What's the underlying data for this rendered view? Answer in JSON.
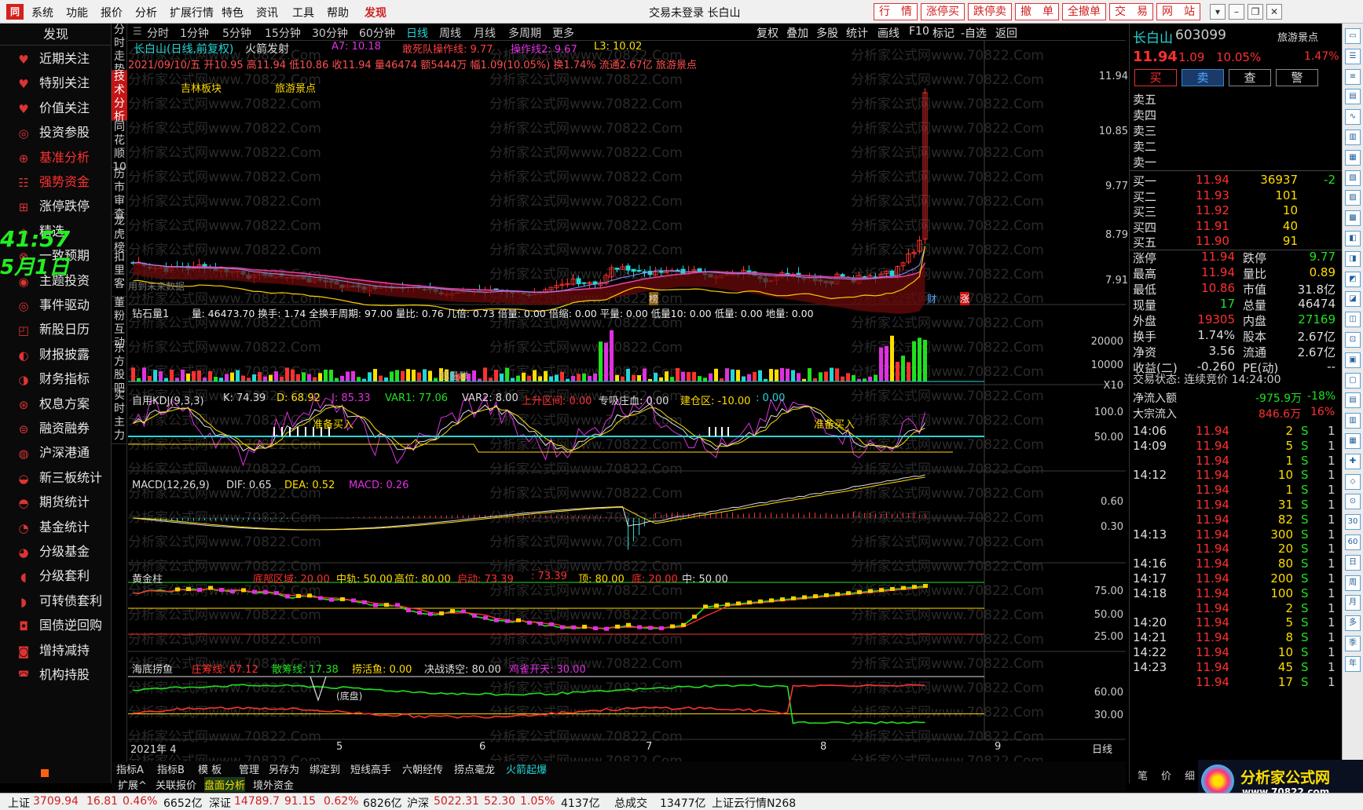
{
  "menubar": {
    "items": [
      "系统",
      "功能",
      "报价",
      "分析",
      "扩展行情",
      "特色",
      "资讯",
      "工具",
      "帮助"
    ],
    "faxian": "发现",
    "title": "交易未登录  长白山",
    "right_buttons": [
      "行　情",
      "涨停买",
      "跌停卖",
      "撤　单",
      "全撤单",
      "交　易",
      "网　站"
    ]
  },
  "sidebar": {
    "find": "发现",
    "items": [
      "近期关注",
      "特别关注",
      "价值关注",
      "投资参股",
      "基准分析",
      "强势资金",
      "涨停跌停",
      "精选",
      "一致预期",
      "主题投资",
      "事件驱动",
      "新股日历",
      "财报披露",
      "财务指标",
      "权息方案",
      "融资融券",
      "沪深港通",
      "新三板统计",
      "期货统计",
      "基金统计",
      "分级基金",
      "分级套利",
      "可转债套利",
      "国债逆回购",
      "增持减持",
      "机构持股"
    ],
    "clock": "41:57",
    "clock_date": "5月1日"
  },
  "vtabs": [
    "分时走势",
    "技术分析",
    "同花顺10",
    "历市审查",
    "龙虎榜",
    "扣里客",
    "董粉互动",
    "东方股吧",
    "实时主力"
  ],
  "periods": [
    "分时",
    "1分钟",
    "5分钟",
    "15分钟",
    "30分钟",
    "60分钟",
    "日线",
    "周线",
    "月线",
    "多周期",
    "更多"
  ],
  "tools": [
    "复权",
    "叠加",
    "多股",
    "统计",
    "画线",
    "F10",
    "标记",
    "-自选",
    "返回"
  ],
  "main": {
    "name": "长白山(日线,前复权)",
    "indicator": "火箭发射",
    "a7": "A7: 10.18",
    "lose": "敢死队操作线: 9.77",
    "op": "操作线2: 9.67",
    "l3": "L3: 10.02",
    "info": "2021/09/10/五  开10.95  高11.94  低10.86  收11.94  量46474  额5444万  幅1.09(10.05%)  换1.74%  流通2.67亿  旅游景点",
    "tag1": "吉林板块",
    "tag2": "旅游景点",
    "future": "用到未来数据",
    "bang": "榜",
    "cai": "财",
    "zhang": "涨",
    "yticks": [
      "11.94",
      "10.85",
      "9.77",
      "8.79",
      "7.91"
    ]
  },
  "vol": {
    "title": "钻石量1",
    "line": "量: 46473.70  换手: 1.74  全换手周期: 97.00  量比: 0.76  几倍: 0.73  倍量: 0.00  倍缩: 0.00  平量: 0.00  低量10: 0.00  低量: 0.00  地量: 0.00",
    "yticks": [
      "20000",
      "10000",
      "X10"
    ],
    "low": "低量群"
  },
  "kdj": {
    "title": "自用KDJ(9,3,3)",
    "k": "K: 74.39",
    "d": "D: 68.92",
    "j": "J: 85.33",
    "var1": "VAR1: 77.06",
    "var2": "VAR2: 8.00",
    "up": "上升区间: 0.00",
    "pro": "专吸庄血: 0.00",
    "build": "建仓区: -10.00",
    "zero": ": 0.00",
    "yticks": [
      "100.0",
      "50.00"
    ],
    "buy": "准备买入",
    "buy2": "准备买入"
  },
  "macd": {
    "title": "MACD(12,26,9)",
    "dif": "DIF: 0.65",
    "dea": "DEA: 0.52",
    "macd": "MACD: 0.26",
    "yticks": [
      "0.60",
      "0.30"
    ]
  },
  "gold": {
    "title": "黄金柱",
    "a": "底部区域: 20.00",
    "b": "中轨: 50.00",
    "c": "高位: 80.00",
    "d": "启动: 73.39",
    "e": ": 73.39",
    "f": "顶: 80.00",
    "g": "底: 20.00",
    "h": "中: 50.00",
    "yticks": [
      "75.00",
      "50.00",
      "25.00"
    ]
  },
  "fish": {
    "title": "海底捞鱼",
    "a": "庄筹线: 67.12",
    "b": "散筹线: 17.38",
    "c": "捞活鱼: 0.00",
    "d": "决战诱空: 80.00",
    "e": "鸡雀开天: 30.00",
    "yticks": [
      "60.00",
      "30.00"
    ],
    "tag": "(底盘)"
  },
  "xaxis": {
    "labels": [
      "2021年 4",
      "5",
      "6",
      "7",
      "8",
      "9"
    ],
    "right": "日线"
  },
  "subbar": {
    "tabs": [
      "指标A",
      "指标B",
      "模 板",
      "管理",
      "另存为",
      "绑定到",
      "短线高手",
      "六朝经传",
      "捞点毫龙",
      "火箭起爆"
    ],
    "tabs2": [
      "扩展^",
      "关联报价",
      "盘面分析",
      "境外资金"
    ]
  },
  "quote": {
    "name": "长白山",
    "code": "603099",
    "sector": "旅游景点",
    "price": "11.94",
    "chg": "1.09",
    "pct": "10.05%",
    "pct2": "1.47%",
    "btns": [
      "买",
      "卖",
      "查",
      "警"
    ],
    "asks": [
      "卖五",
      "卖四",
      "卖三",
      "卖二",
      "卖一"
    ],
    "bids": [
      {
        "l": "买一",
        "p": "11.94",
        "v": "36937",
        "x": "-2"
      },
      {
        "l": "买二",
        "p": "11.93",
        "v": "101",
        "x": ""
      },
      {
        "l": "买三",
        "p": "11.92",
        "v": "10",
        "x": ""
      },
      {
        "l": "买四",
        "p": "11.91",
        "v": "40",
        "x": ""
      },
      {
        "l": "买五",
        "p": "11.90",
        "v": "91",
        "x": ""
      }
    ],
    "stats": [
      {
        "a": "涨停",
        "b": "11.94",
        "c": "跌停",
        "d": "9.77"
      },
      {
        "a": "最高",
        "b": "11.94",
        "c": "量比",
        "d": "0.89"
      },
      {
        "a": "最低",
        "b": "10.86",
        "c": "市值",
        "d": "31.8亿"
      },
      {
        "a": "现量",
        "b": "17",
        "c": "总量",
        "d": "46474"
      },
      {
        "a": "外盘",
        "b": "19305",
        "c": "内盘",
        "d": "27169"
      },
      {
        "a": "换手",
        "b": "1.74%",
        "c": "股本",
        "d": "2.67亿"
      },
      {
        "a": "净资",
        "b": "3.56",
        "c": "流通",
        "d": "2.67亿"
      },
      {
        "a": "收益(二)",
        "b": "-0.260",
        "c": "PE(动)",
        "d": "--"
      }
    ],
    "status": "交易状态: 连续竞价 14:24:00",
    "flow1": {
      "a": "净流入额",
      "b": "-975.9万",
      "c": "-18%"
    },
    "flow2": {
      "a": "大宗流入",
      "b": "846.6万",
      "c": "16%"
    },
    "ticks": [
      {
        "t": "14:06",
        "p": "11.94",
        "v": "2",
        "s": "S",
        "n": "1"
      },
      {
        "t": "14:09",
        "p": "11.94",
        "v": "5",
        "s": "S",
        "n": "1"
      },
      {
        "t": "",
        "p": "11.94",
        "v": "1",
        "s": "S",
        "n": "1"
      },
      {
        "t": "14:12",
        "p": "11.94",
        "v": "10",
        "s": "S",
        "n": "1"
      },
      {
        "t": "",
        "p": "11.94",
        "v": "1",
        "s": "S",
        "n": "1"
      },
      {
        "t": "",
        "p": "11.94",
        "v": "31",
        "s": "S",
        "n": "1"
      },
      {
        "t": "",
        "p": "11.94",
        "v": "82",
        "s": "S",
        "n": "1"
      },
      {
        "t": "14:13",
        "p": "11.94",
        "v": "300",
        "s": "S",
        "n": "1"
      },
      {
        "t": "",
        "p": "11.94",
        "v": "20",
        "s": "S",
        "n": "1"
      },
      {
        "t": "14:16",
        "p": "11.94",
        "v": "80",
        "s": "S",
        "n": "1"
      },
      {
        "t": "14:17",
        "p": "11.94",
        "v": "200",
        "s": "S",
        "n": "1"
      },
      {
        "t": "14:18",
        "p": "11.94",
        "v": "100",
        "s": "S",
        "n": "1"
      },
      {
        "t": "",
        "p": "11.94",
        "v": "2",
        "s": "S",
        "n": "1"
      },
      {
        "t": "14:20",
        "p": "11.94",
        "v": "5",
        "s": "S",
        "n": "1"
      },
      {
        "t": "14:21",
        "p": "11.94",
        "v": "8",
        "s": "S",
        "n": "1"
      },
      {
        "t": "14:22",
        "p": "11.94",
        "v": "10",
        "s": "S",
        "n": "1"
      },
      {
        "t": "14:23",
        "p": "11.94",
        "v": "45",
        "s": "S",
        "n": "1"
      },
      {
        "t": "",
        "p": "11.94",
        "v": "17",
        "s": "S",
        "n": "1"
      }
    ],
    "tabs": [
      "笔",
      "价",
      "细"
    ]
  },
  "iconstrip": [
    "",
    "",
    "",
    "",
    "",
    "",
    "",
    "",
    "",
    "",
    "",
    "",
    "",
    "",
    "",
    "",
    "",
    "",
    "",
    "",
    "",
    "",
    "",
    "",
    "30",
    "60",
    "日",
    "周",
    "月",
    "多",
    "季",
    "年"
  ],
  "bottom": {
    "sh": "上证",
    "sh_v": "3709.94",
    "sh_c": "16.81",
    "sh_p": "0.46%",
    "sh_a": "6652亿",
    "sz": "深证",
    "sz_v": "14789.7",
    "sz_c": "91.15",
    "sz_p": "0.62%",
    "sz_a": "6826亿",
    "hs": "沪深",
    "hs_v": "5022.31",
    "hs_c": "52.30",
    "hs_p": "1.05%",
    "hs_a": "4137亿",
    "tot": "总成交",
    "tot_v": "13477亿",
    "cloud": "上证云行情N268"
  },
  "logo": {
    "text": "分析家公式网",
    "url": "www.70822.com"
  },
  "watermark": "分析家公式网www.70822.Com"
}
